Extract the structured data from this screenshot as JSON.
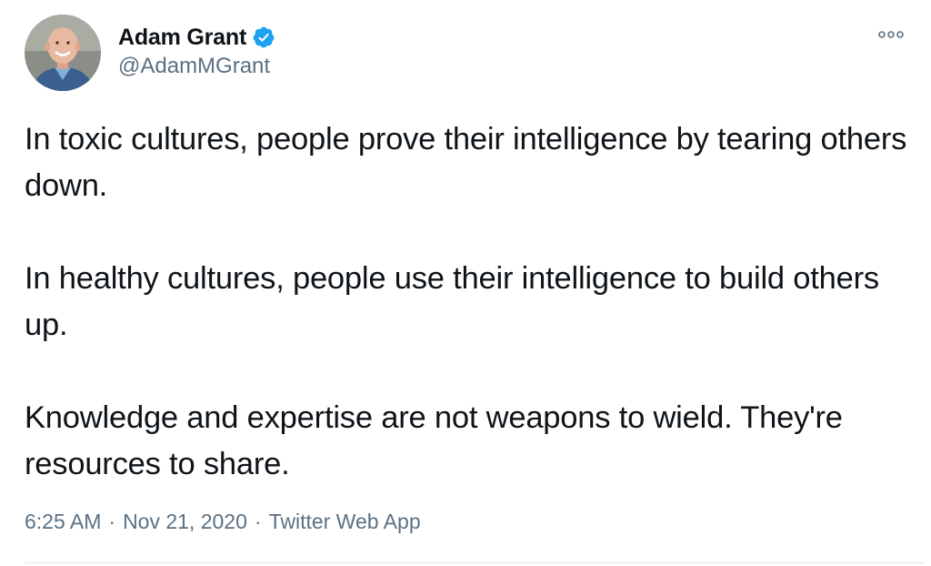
{
  "author": {
    "display_name": "Adam Grant",
    "handle": "@AdamMGrant",
    "verified": true,
    "avatar_icon": "profile-photo"
  },
  "more_icon": "ellipsis-icon",
  "tweet": {
    "paragraphs": [
      "In toxic cultures, people prove their intelligence by tearing others down.",
      "In healthy cultures, people use their intelligence to build others up.",
      "Knowledge and expertise are not weapons to wield. They're resources to share."
    ]
  },
  "meta": {
    "time": "6:25 AM",
    "date": "Nov 21, 2020",
    "separator": "·",
    "source": "Twitter Web App"
  },
  "colors": {
    "text": "#0f1419",
    "secondary": "#5b7083",
    "verified": "#1da1f2",
    "divider": "#e1e8ed"
  }
}
